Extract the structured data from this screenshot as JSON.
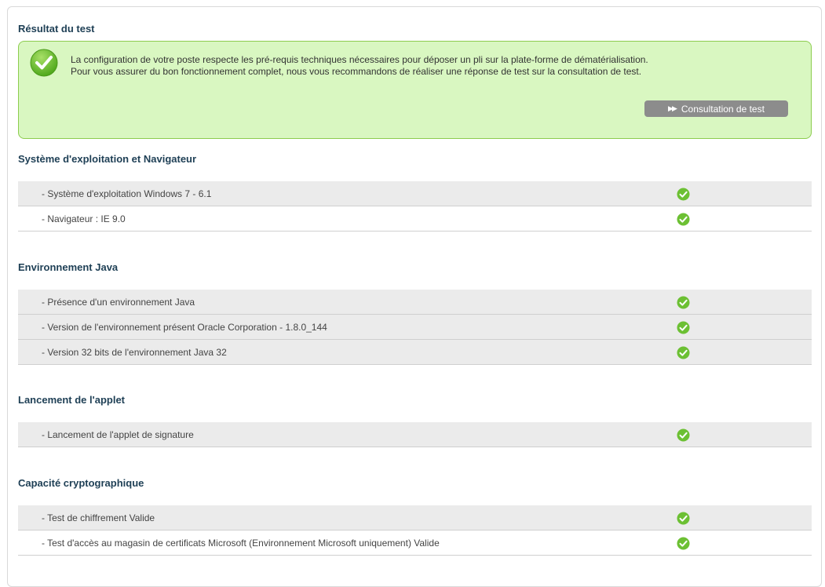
{
  "result": {
    "title": "Résultat du test",
    "message_line1": "La configuration de votre poste respecte les pré-requis techniques nécessaires pour déposer un pli sur la plate-forme de dématérialisation.",
    "message_line2": "Pour vous assurer du bon fonctionnement complet, nous vous recommandons de réaliser une réponse de test sur la consultation de test.",
    "button_label": "Consultation de test",
    "button_icon": "double-chevron-right-icon"
  },
  "sections": [
    {
      "title": "Système d'exploitation et Navigateur",
      "rows": [
        {
          "label": "- Système d'exploitation Windows 7 - 6.1",
          "status": "ok"
        },
        {
          "label": "- Navigateur : IE 9.0",
          "status": "ok"
        }
      ]
    },
    {
      "title": "Environnement Java",
      "rows": [
        {
          "label": "- Présence d'un environnement Java",
          "status": "ok"
        },
        {
          "label": "- Version de l'environnement présent Oracle Corporation - 1.8.0_144",
          "status": "ok"
        },
        {
          "label": "- Version 32 bits de l'environnement Java 32",
          "status": "ok"
        }
      ]
    },
    {
      "title": "Lancement de l'applet",
      "rows": [
        {
          "label": "- Lancement de l'applet de signature",
          "status": "ok"
        }
      ]
    },
    {
      "title": "Capacité cryptographique",
      "rows": [
        {
          "label": "- Test de chiffrement Valide",
          "status": "ok"
        },
        {
          "label": "- Test d'accès au magasin de certificats Microsoft (Environnement Microsoft uniquement) Valide",
          "status": "ok"
        }
      ]
    }
  ],
  "colors": {
    "success_bg": "#d9f7c1",
    "success_border": "#8ccc4e",
    "check_green": "#6cc033",
    "heading": "#1e3f55"
  }
}
